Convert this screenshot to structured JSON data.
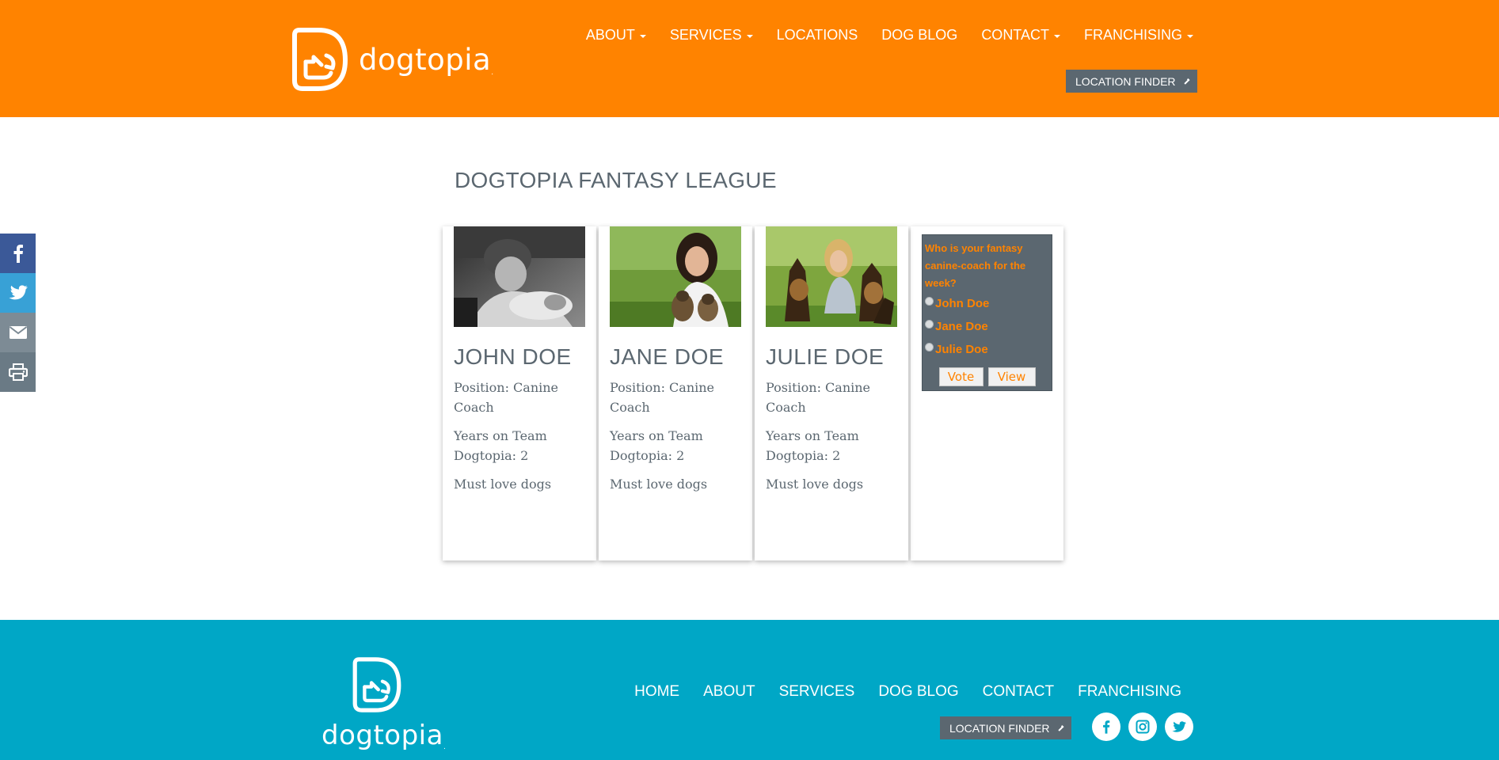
{
  "brand": {
    "name": "dogtopia",
    "reg": "."
  },
  "header": {
    "nav": [
      {
        "label": "ABOUT",
        "dropdown": true
      },
      {
        "label": "SERVICES",
        "dropdown": true
      },
      {
        "label": "LOCATIONS",
        "dropdown": false
      },
      {
        "label": "DOG BLOG",
        "dropdown": false
      },
      {
        "label": "CONTACT",
        "dropdown": true
      },
      {
        "label": "FRANCHISING",
        "dropdown": true
      }
    ],
    "location_finder": "LOCATION FINDER"
  },
  "share": {
    "icons": [
      "facebook-icon",
      "twitter-icon",
      "envelope-icon",
      "print-icon"
    ]
  },
  "main": {
    "title": "DOGTOPIA FANTASY LEAGUE",
    "coaches": [
      {
        "name": "JOHN DOE",
        "position": "Position: Canine Coach",
        "years": "Years on Team Dogtopia: 2",
        "note": "Must love dogs"
      },
      {
        "name": "JANE DOE",
        "position": "Position: Canine Coach",
        "years": "Years on Team Dogtopia: 2",
        "note": "Must love dogs"
      },
      {
        "name": "JULIE DOE",
        "position": "Position: Canine Coach",
        "years": "Years on Team Dogtopia: 2",
        "note": "Must love dogs"
      }
    ],
    "poll": {
      "question": "Who is your fantasy canine-coach for the week?",
      "options": [
        "John Doe",
        "Jane Doe",
        "Julie Doe"
      ],
      "vote_label": "Vote",
      "view_label": "View"
    }
  },
  "footer": {
    "nav": [
      "HOME",
      "ABOUT",
      "SERVICES",
      "DOG BLOG",
      "CONTACT",
      "FRANCHISING"
    ],
    "location_finder": "LOCATION FINDER",
    "social_icons": [
      "facebook-icon",
      "instagram-icon",
      "twitter-icon"
    ]
  },
  "colors": {
    "brand_orange": "#ff8300",
    "slate": "#5b6770",
    "footer_teal": "#00a7c6"
  }
}
